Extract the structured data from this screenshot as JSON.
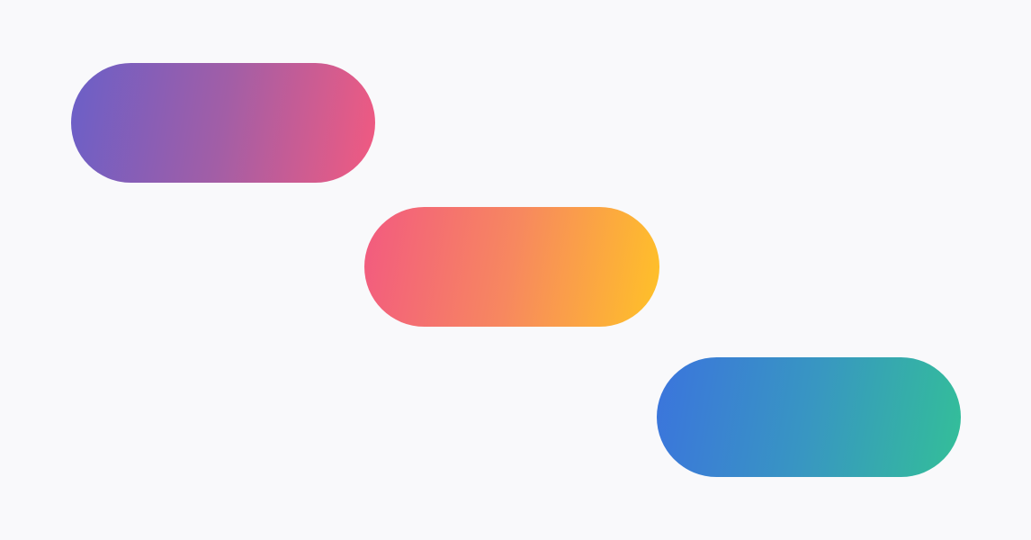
{
  "pills": [
    {
      "name": "pill-purple-pink",
      "gradient": [
        "#6a5fc8",
        "#a25ea6",
        "#f25a80"
      ]
    },
    {
      "name": "pill-pink-yellow",
      "gradient": [
        "#f25a80",
        "#f7885f",
        "#ffc227"
      ]
    },
    {
      "name": "pill-blue-teal",
      "gradient": [
        "#3b74dd",
        "#3896c2",
        "#33bf98"
      ]
    }
  ]
}
